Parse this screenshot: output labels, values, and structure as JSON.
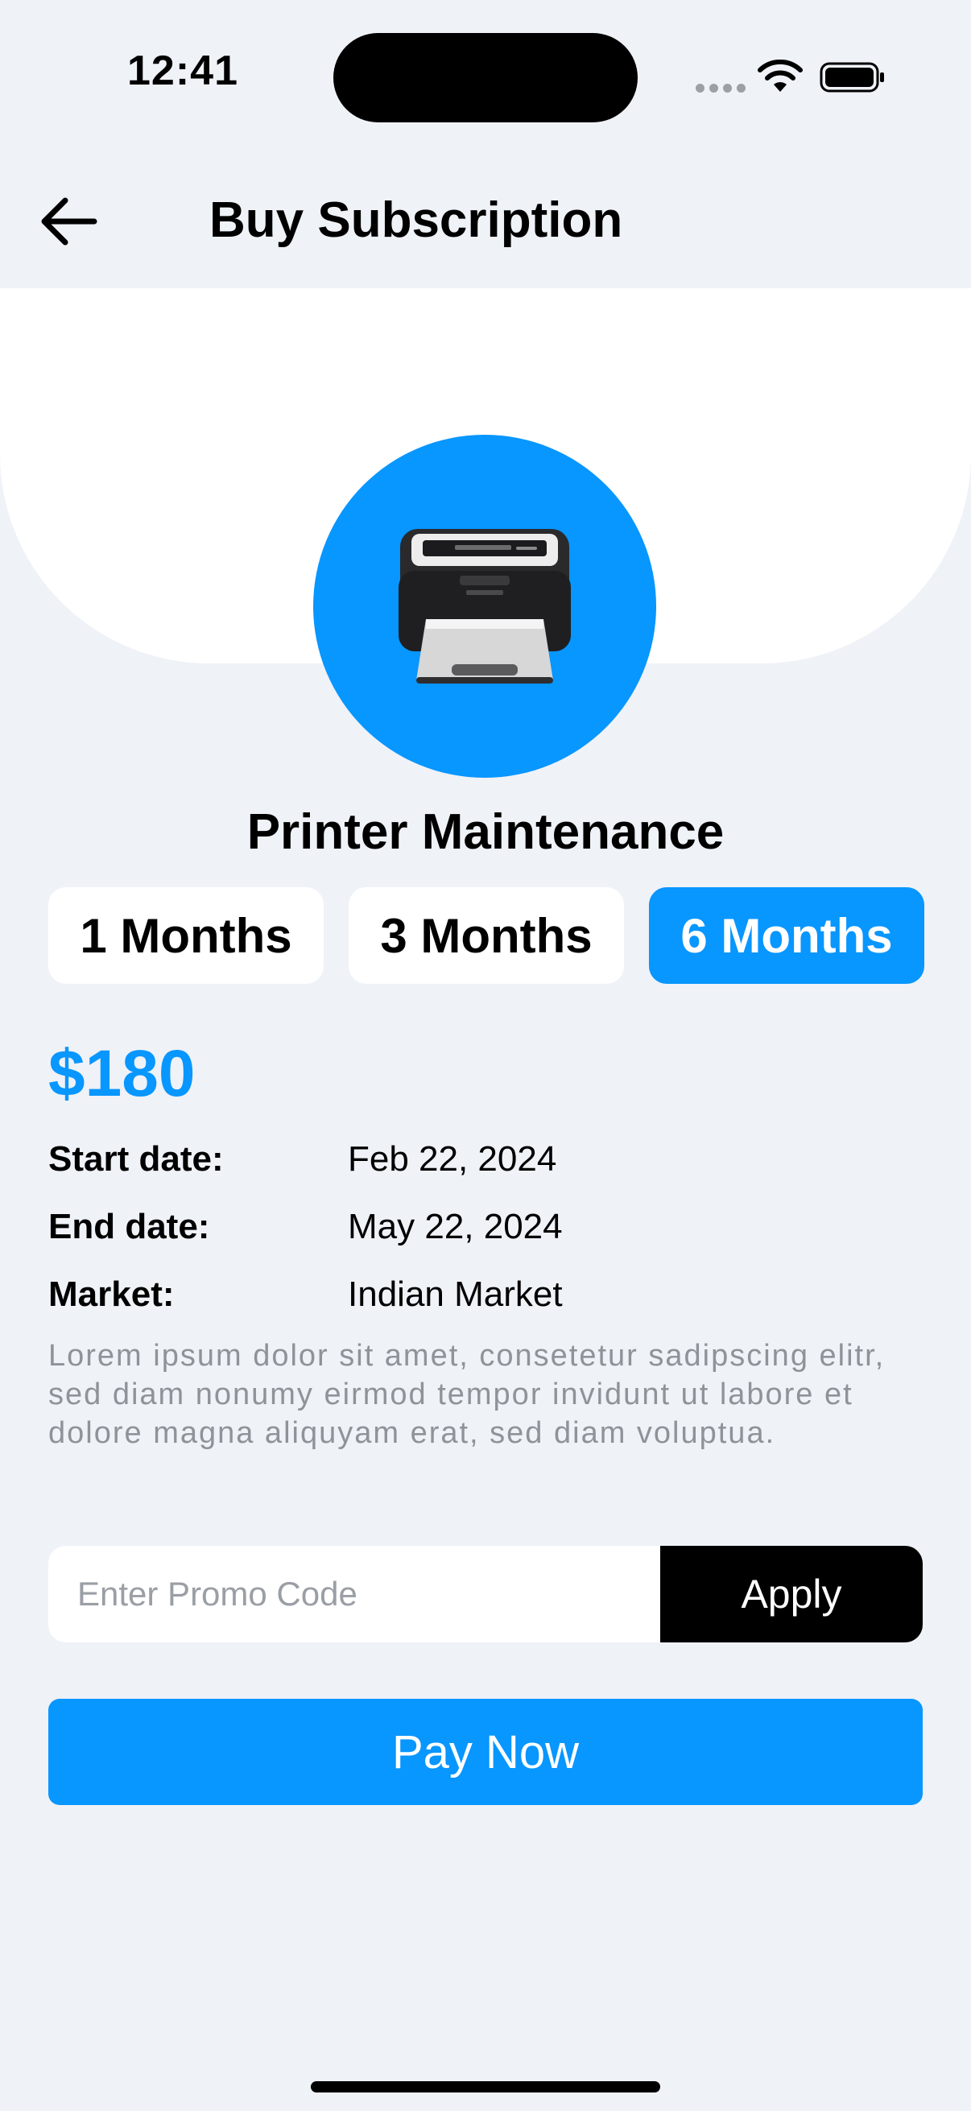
{
  "status_bar": {
    "time": "12:41",
    "icons": [
      "signal-dots-icon",
      "wifi-icon",
      "battery-icon"
    ]
  },
  "header": {
    "back_icon": "arrow-left-icon",
    "title": "Buy Subscription"
  },
  "service": {
    "icon": "printer-icon",
    "name": "Printer Maintenance"
  },
  "durations": {
    "options": [
      "1 Months",
      "3 Months",
      "6 Months"
    ],
    "selected": "6 Months"
  },
  "price": "$180",
  "details": [
    {
      "label": "Start date:",
      "value": "Feb 22, 2024"
    },
    {
      "label": "End date:",
      "value": "May 22, 2024"
    },
    {
      "label": "Market:",
      "value": "Indian Market"
    }
  ],
  "description": "Lorem ipsum dolor sit amet, consetetur sadipscing elitr, sed diam nonumy eirmod tempor invidunt ut labore et dolore magna aliquyam erat, sed diam voluptua.",
  "promo": {
    "placeholder": "Enter Promo Code",
    "value": "",
    "apply_label": "Apply"
  },
  "pay_label": "Pay Now",
  "colors": {
    "accent": "#0896ff",
    "background": "#eff2f7",
    "muted_text": "#8e939a"
  }
}
